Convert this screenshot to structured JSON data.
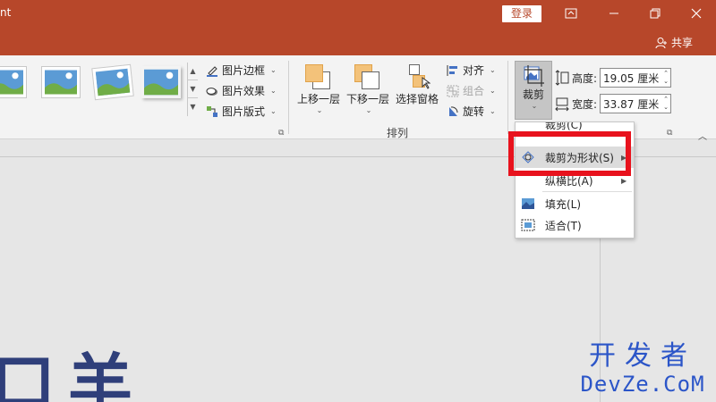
{
  "titlebar": {
    "app_title": "nt",
    "login_label": "登录",
    "share_label": "共享"
  },
  "ribbon": {
    "picture_styles": {
      "border_label": "图片边框",
      "effects_label": "图片效果",
      "layout_label": "图片版式"
    },
    "arrange": {
      "bring_forward_label": "上移一层",
      "send_backward_label": "下移一层",
      "selection_pane_label": "选择窗格",
      "align_label": "对齐",
      "group_label": "组合",
      "rotate_label": "旋转",
      "group_title": "排列"
    },
    "size": {
      "crop_label": "裁剪",
      "height_label": "高度:",
      "height_value": "19.05 厘米",
      "width_label": "宽度:",
      "width_value": "33.87 厘米"
    }
  },
  "crop_menu": {
    "partial_label": "裁剪(C)",
    "items": [
      {
        "label": "裁剪为形状(S)"
      },
      {
        "label": "纵横比(A)"
      },
      {
        "label": "填充(L)"
      },
      {
        "label": "适合(T)"
      }
    ]
  },
  "slide": {
    "partial_text": "口羊"
  },
  "watermark": {
    "line1": "开发者",
    "line2": "DevZe.CoM"
  },
  "colors": {
    "title_bar": "#b7472a",
    "highlight": "#e8121d",
    "watermark": "#2b55c8"
  }
}
